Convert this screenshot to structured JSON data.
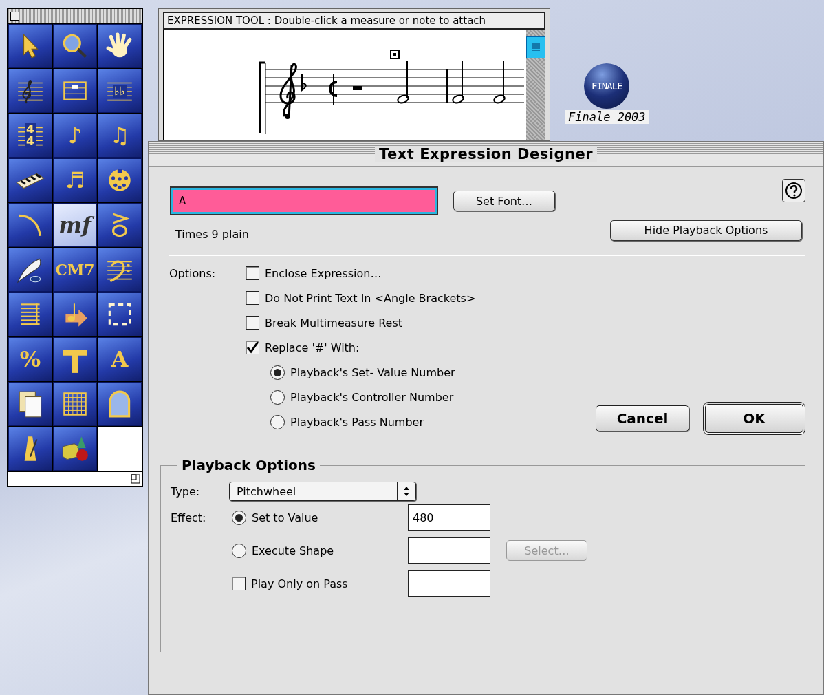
{
  "palette": {
    "tools": [
      {
        "kind": "pointer",
        "selected": false
      },
      {
        "kind": "magnifier",
        "selected": false
      },
      {
        "kind": "hand",
        "selected": false
      },
      {
        "kind": "clef-staff",
        "selected": false
      },
      {
        "kind": "measure",
        "selected": false
      },
      {
        "kind": "staff",
        "glyph": "♭♭",
        "selected": false
      },
      {
        "kind": "staff",
        "glyph": "4 4",
        "selected": false
      },
      {
        "kind": "glyph",
        "glyph": "♪",
        "selected": false
      },
      {
        "kind": "glyph",
        "glyph": "♫",
        "selected": false
      },
      {
        "kind": "keyboard",
        "selected": false
      },
      {
        "kind": "glyph",
        "glyph": "♬",
        "selected": false
      },
      {
        "kind": "midi",
        "selected": false
      },
      {
        "kind": "slur",
        "selected": false
      },
      {
        "kind": "glyph",
        "glyph": "mf",
        "selected": true
      },
      {
        "kind": "accent",
        "selected": false
      },
      {
        "kind": "quill",
        "selected": false
      },
      {
        "kind": "glyph",
        "glyph": "CM7",
        "selected": false
      },
      {
        "kind": "bass-staff",
        "selected": false
      },
      {
        "kind": "staff-tool",
        "selected": false
      },
      {
        "kind": "arrow-note",
        "selected": false
      },
      {
        "kind": "marquee",
        "selected": false
      },
      {
        "kind": "glyph",
        "glyph": "%",
        "selected": false
      },
      {
        "kind": "hammer",
        "selected": false
      },
      {
        "kind": "glyph",
        "glyph": "A",
        "selected": false
      },
      {
        "kind": "page",
        "selected": false
      },
      {
        "kind": "grid",
        "selected": false
      },
      {
        "kind": "arch",
        "selected": false
      },
      {
        "kind": "metronome",
        "selected": false
      },
      {
        "kind": "shapes",
        "selected": false
      }
    ]
  },
  "score_window": {
    "prompt": "EXPRESSION TOOL : Double-click a measure or note to attach"
  },
  "desktop_icon": {
    "logo_text": "FINALE",
    "label": "Finale 2003"
  },
  "dialog": {
    "title": "Text Expression Designer",
    "text_field": {
      "value": "A"
    },
    "set_font_button": "Set Font…",
    "font_description": "Times 9 plain",
    "hide_button": "Hide Playback Options",
    "options_label": "Options:",
    "checkboxes": [
      {
        "label": "Enclose Expression…",
        "checked": false
      },
      {
        "label": "Do Not Print Text In <Angle Brackets>",
        "checked": false
      },
      {
        "label": "Break Multimeasure Rest",
        "checked": false
      },
      {
        "label": "Replace '#' With:",
        "checked": true
      }
    ],
    "radios": [
      {
        "label": "Playback's Set- Value Number",
        "selected": true
      },
      {
        "label": "Playback's Controller Number",
        "selected": false
      },
      {
        "label": "Playback's Pass Number",
        "selected": false
      }
    ],
    "cancel_button": "Cancel",
    "ok_button": "OK",
    "playback": {
      "title": "Playback Options",
      "type_label": "Type:",
      "type_value": "Pitchwheel",
      "effect_label": "Effect:",
      "effects": [
        {
          "kind": "radio",
          "label": "Set to Value",
          "selected": true,
          "value": "480"
        },
        {
          "kind": "radio",
          "label": "Execute Shape",
          "selected": false,
          "button": "Select…",
          "button_disabled": true
        },
        {
          "kind": "checkbox",
          "label": "Play Only on Pass",
          "checked": false
        }
      ]
    }
  }
}
